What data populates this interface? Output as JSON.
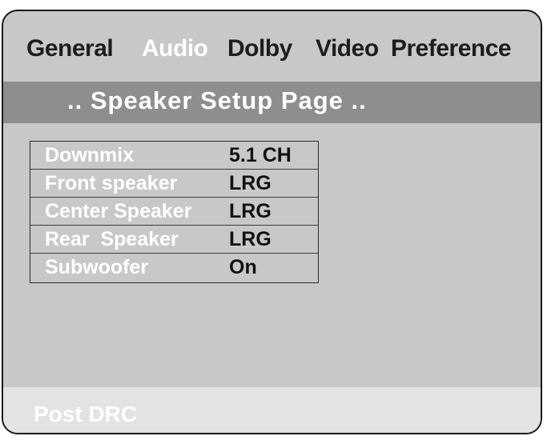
{
  "tabs": [
    {
      "label": "General",
      "active": false
    },
    {
      "label": "Audio",
      "active": true
    },
    {
      "label": "Dolby",
      "active": false
    },
    {
      "label": "Video",
      "active": false
    },
    {
      "label": "Preference",
      "active": false
    }
  ],
  "page": {
    "title": ".. Speaker Setup Page .."
  },
  "settings": [
    {
      "label": "Downmix",
      "value": "5.1 CH"
    },
    {
      "label": "Front speaker",
      "value": "LRG"
    },
    {
      "label": "Center Speaker",
      "value": "LRG"
    },
    {
      "label": "Rear  Speaker",
      "value": "LRG"
    },
    {
      "label": "Subwoofer",
      "value": "On"
    }
  ],
  "footer": {
    "text": "Post DRC"
  },
  "colors": {
    "panel_background": "#c8c8c9",
    "header_bar": "#8e8e8f",
    "footer_bar": "#e3e3e3",
    "active_tab": "#ffffff",
    "inactive_tab": "#1d1d1f"
  }
}
